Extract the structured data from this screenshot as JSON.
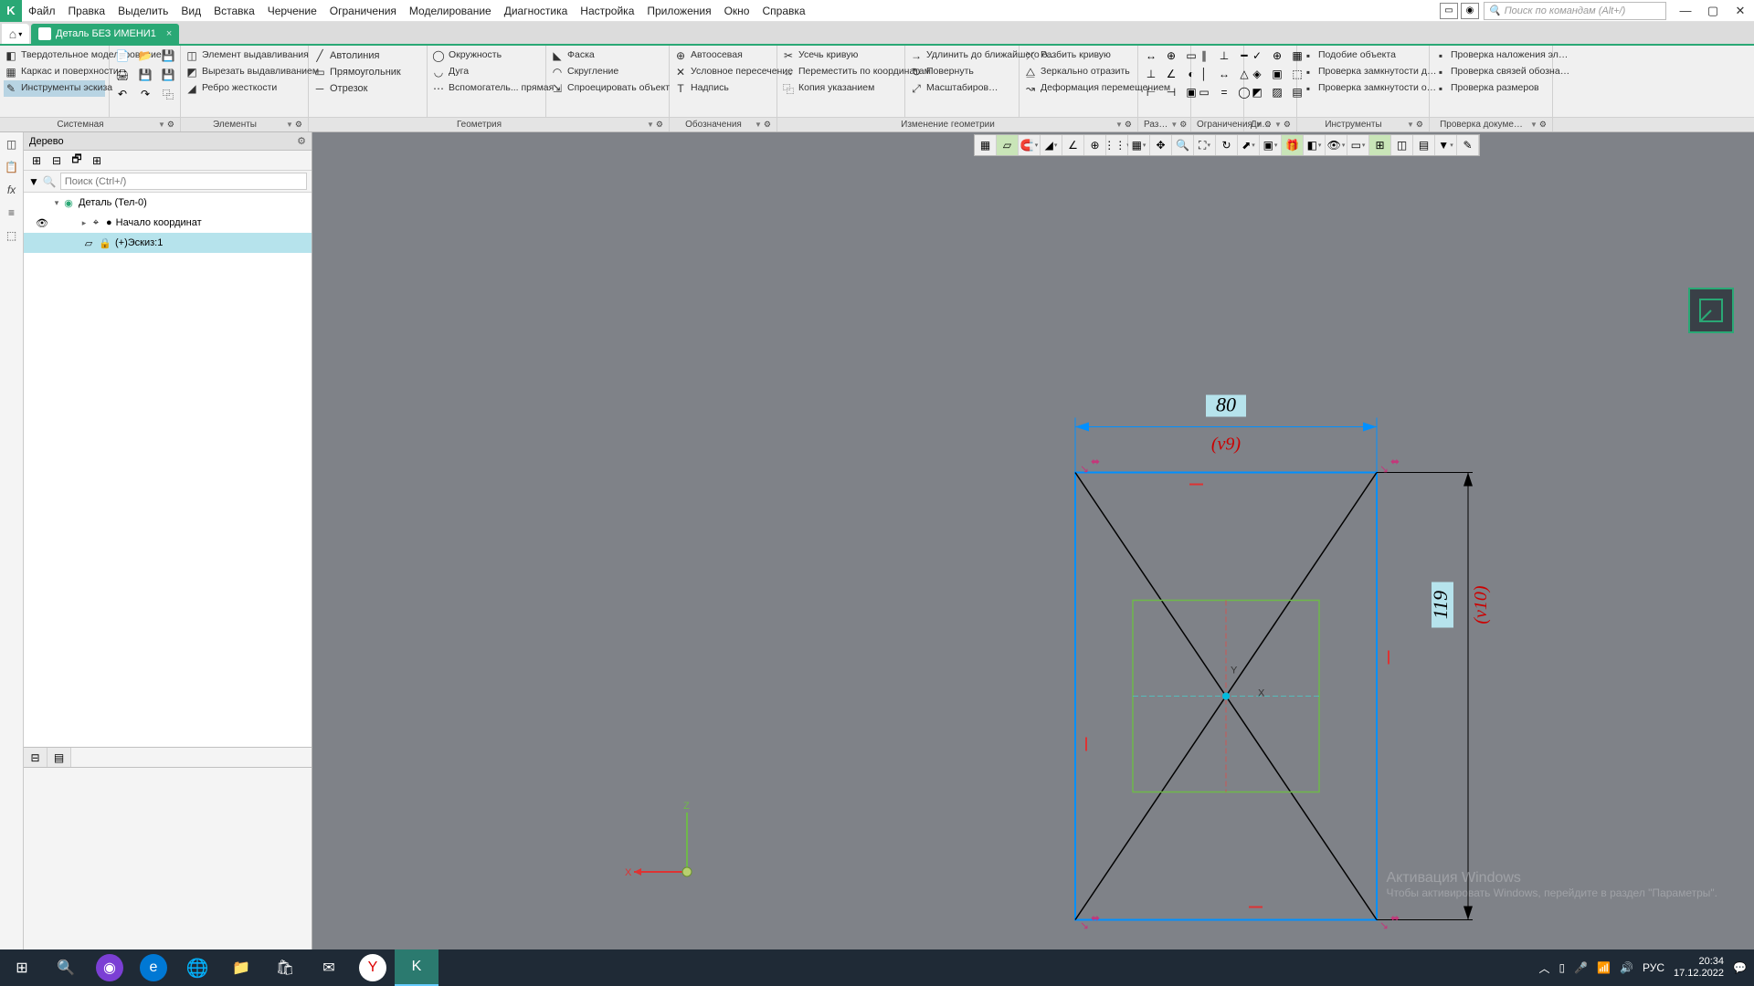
{
  "menubar": [
    "Файл",
    "Правка",
    "Выделить",
    "Вид",
    "Вставка",
    "Черчение",
    "Ограничения",
    "Моделирование",
    "Диагностика",
    "Настройка",
    "Приложения",
    "Окно",
    "Справка"
  ],
  "search_placeholder": "Поиск по командам (Alt+/)",
  "doc_tab": "Деталь БЕЗ ИМЕНИ1",
  "panels": {
    "modes": [
      {
        "label": "Твердотельное моделирование",
        "icon": "◧"
      },
      {
        "label": "Каркас и поверхности",
        "icon": "▦"
      },
      {
        "label": "Инструменты эскиза",
        "icon": "✎",
        "sel": true
      }
    ],
    "elements": [
      {
        "label": "Элемент выдавливания",
        "icon": "◫"
      },
      {
        "label": "Вырезать выдавливанием",
        "icon": "◩"
      },
      {
        "label": "Ребро жесткости",
        "icon": "◢"
      }
    ],
    "geom": [
      {
        "label": "Автолиния",
        "icon": "╱"
      },
      {
        "label": "Прямоугольник",
        "icon": "▭"
      },
      {
        "label": "Отрезок",
        "icon": "─"
      }
    ],
    "geom2": [
      {
        "label": "Окружность",
        "icon": "◯"
      },
      {
        "label": "Дуга",
        "icon": "◡"
      },
      {
        "label": "Вспомогатель... прямая",
        "icon": "⋯"
      }
    ],
    "geom3": [
      {
        "label": "Фаска",
        "icon": "◣"
      },
      {
        "label": "Скругление",
        "icon": "◠"
      },
      {
        "label": "Спроецировать объект",
        "icon": "⇲"
      }
    ],
    "annot": [
      {
        "label": "Автоосевая",
        "icon": "⊕"
      },
      {
        "label": "Условное пересечение",
        "icon": "✕"
      },
      {
        "label": "Надпись",
        "icon": "T"
      }
    ],
    "change": [
      {
        "label": "Усечь кривую",
        "icon": "✂"
      },
      {
        "label": "Переместить по координатам",
        "icon": "↔"
      },
      {
        "label": "Копия указанием",
        "icon": "⿻"
      }
    ],
    "change2": [
      {
        "label": "Удлинить до ближайшего о…",
        "icon": "→"
      },
      {
        "label": "Повернуть",
        "icon": "↻"
      },
      {
        "label": "Масштабиров…",
        "icon": "⤢"
      }
    ],
    "change3": [
      {
        "label": "Разбить кривую",
        "icon": "⤫"
      },
      {
        "label": "Зеркально отразить",
        "icon": "⧋"
      },
      {
        "label": "Деформация перемещением",
        "icon": "↝"
      }
    ],
    "instr": [
      {
        "label": "Подобие объекта"
      },
      {
        "label": "Проверка замкнутости д…"
      },
      {
        "label": "Проверка замкнутости о…"
      }
    ],
    "check": [
      {
        "label": "Проверка наложения эл…"
      },
      {
        "label": "Проверка связей обозна…"
      },
      {
        "label": "Проверка размеров"
      }
    ]
  },
  "rib_names": [
    "Системная",
    "Элементы",
    "Геометрия",
    "Обозначения",
    "Изменение геометрии",
    "Раз…",
    "Ограничения",
    "Ди…",
    "Инструменты",
    "Проверка докуме…"
  ],
  "tree": {
    "title": "Дерево",
    "search_placeholder": "Поиск (Ctrl+/)",
    "root": "Деталь (Тел-0)",
    "origin": "Начало координат",
    "sketch": "(+)Эскиз:1"
  },
  "dims": {
    "width": "80",
    "wvar": "(v9)",
    "height": "119",
    "hvar": "(v10)"
  },
  "activate": {
    "l1": "Активация Windows",
    "l2": "Чтобы активировать Windows, перейдите в раздел \"Параметры\"."
  },
  "taskbar": {
    "lang": "РУС",
    "time": "20:34",
    "date": "17.12.2022"
  }
}
